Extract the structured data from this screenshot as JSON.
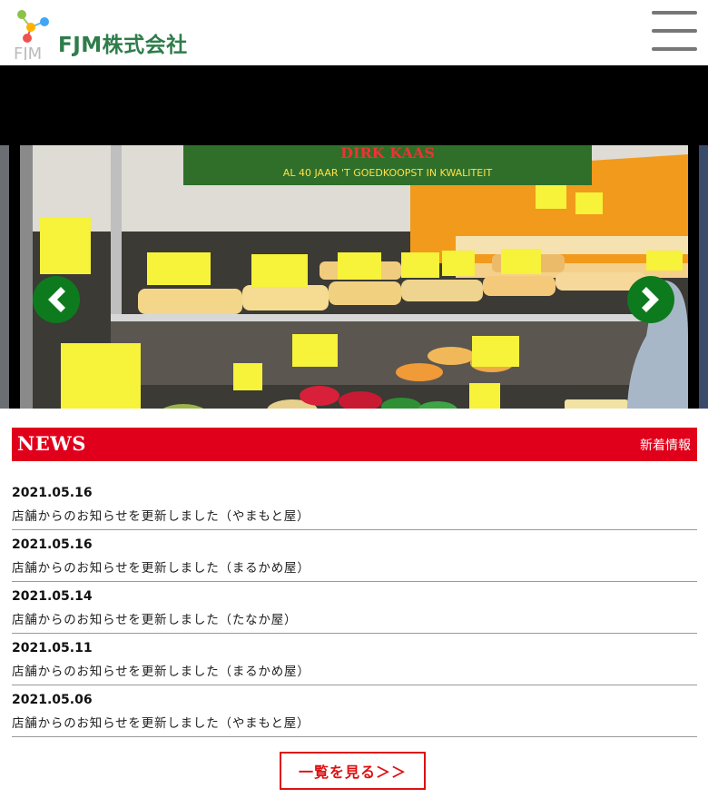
{
  "header": {
    "logo_mark": "FJM",
    "company_name": "FJM株式会社",
    "menu_icon": "hamburger-icon"
  },
  "slider": {
    "banner_text": "DIRK KAAS",
    "banner_sub": "AL 40 JAAR 'T GOEDKOOPST IN KWALITEIT",
    "prev_icon": "chevron-left-icon",
    "next_icon": "chevron-right-icon"
  },
  "news": {
    "title": "NEWS",
    "subtitle": "新着情報",
    "items": [
      {
        "date": "2021.05.16",
        "text": "店舗からのお知らせを更新しました（やまもと屋）"
      },
      {
        "date": "2021.05.16",
        "text": "店舗からのお知らせを更新しました（まるかめ屋）"
      },
      {
        "date": "2021.05.14",
        "text": "店舗からのお知らせを更新しました（たなか屋）"
      },
      {
        "date": "2021.05.11",
        "text": "店舗からのお知らせを更新しました（まるかめ屋）"
      },
      {
        "date": "2021.05.06",
        "text": "店舗からのお知らせを更新しました（やまもと屋）"
      }
    ],
    "more_label": "一覧を見る＞＞"
  },
  "colors": {
    "accent_red": "#e0001b",
    "brand_green": "#2e7d4a",
    "arrow_green": "#0e7a1e"
  }
}
